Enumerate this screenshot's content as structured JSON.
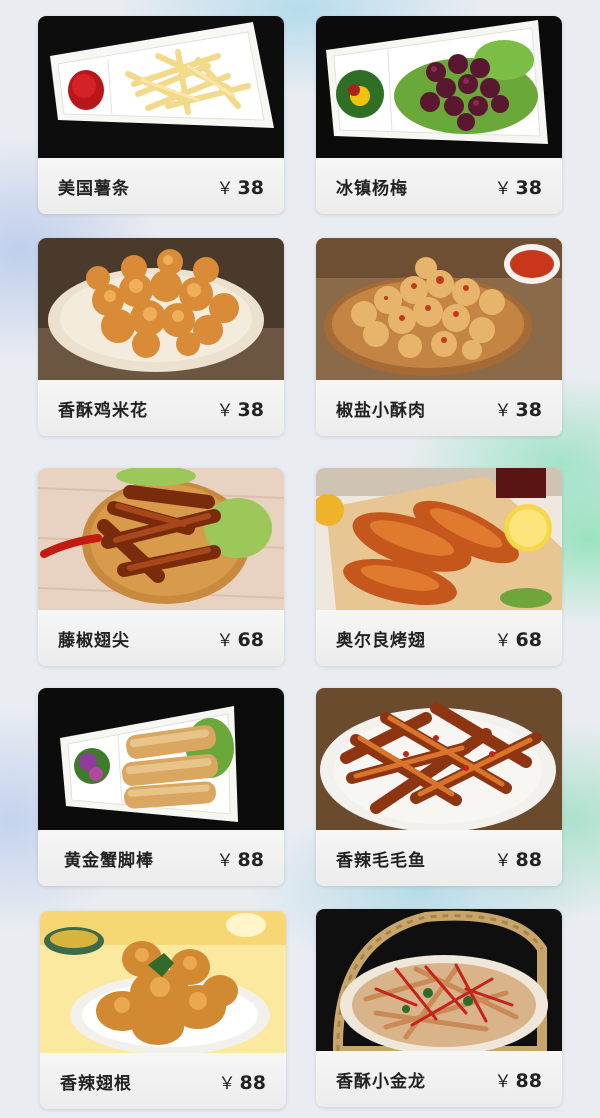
{
  "currency_symbol": "￥",
  "menu": [
    {
      "name": "美国薯条",
      "price": "38"
    },
    {
      "name": "冰镇杨梅",
      "price": "38"
    },
    {
      "name": "香酥鸡米花",
      "price": "38"
    },
    {
      "name": "椒盐小酥肉",
      "price": "38"
    },
    {
      "name": "藤椒翅尖",
      "price": "68"
    },
    {
      "name": "奥尔良烤翅",
      "price": "68"
    },
    {
      "name": "黄金蟹脚棒",
      "price": "88"
    },
    {
      "name": "香辣毛毛鱼",
      "price": "88"
    },
    {
      "name": "香辣翅根",
      "price": "88"
    },
    {
      "name": "香酥小金龙",
      "price": "88"
    }
  ]
}
